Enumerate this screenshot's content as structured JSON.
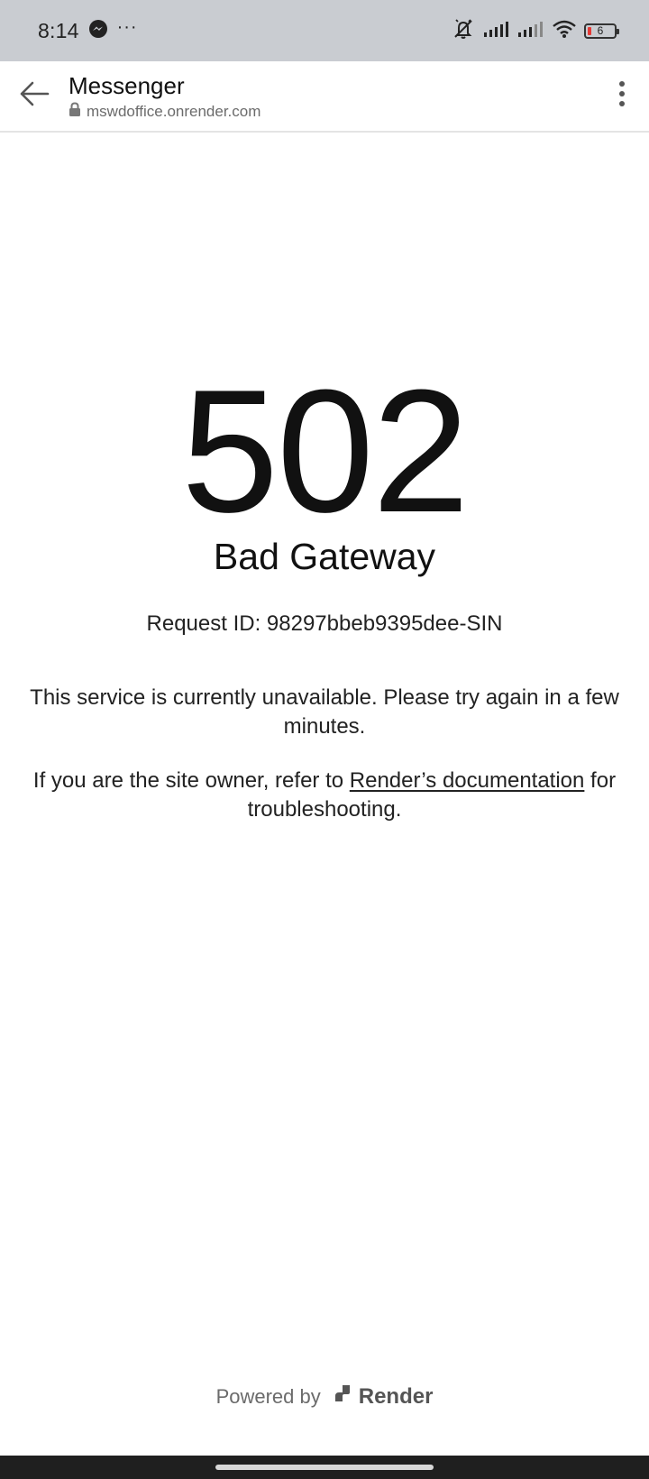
{
  "status_bar": {
    "time": "8:14",
    "dots": "···",
    "battery_level": "6",
    "icons": [
      "messenger-icon",
      "silent-bell-icon",
      "signal-icon",
      "signal-icon",
      "wifi-icon",
      "battery-icon"
    ],
    "battery_low_color": "#e53935"
  },
  "browser": {
    "title": "Messenger",
    "url": "mswdoffice.onrender.com",
    "icons": [
      "back-arrow-icon",
      "lock-icon",
      "more-vert-icon"
    ]
  },
  "error": {
    "code": "502",
    "title": "Bad Gateway",
    "request_id": "Request ID: 98297bbeb9395dee-SIN",
    "message": "This service is currently unavailable. Please try again in a few minutes.",
    "owner_prefix": "If you are the site owner, refer to ",
    "doc_link": "Render’s documentation",
    "owner_suffix": " for troubleshooting."
  },
  "footer": {
    "powered_by": "Powered by",
    "brand": "Render",
    "icon": "render-logo-icon"
  }
}
